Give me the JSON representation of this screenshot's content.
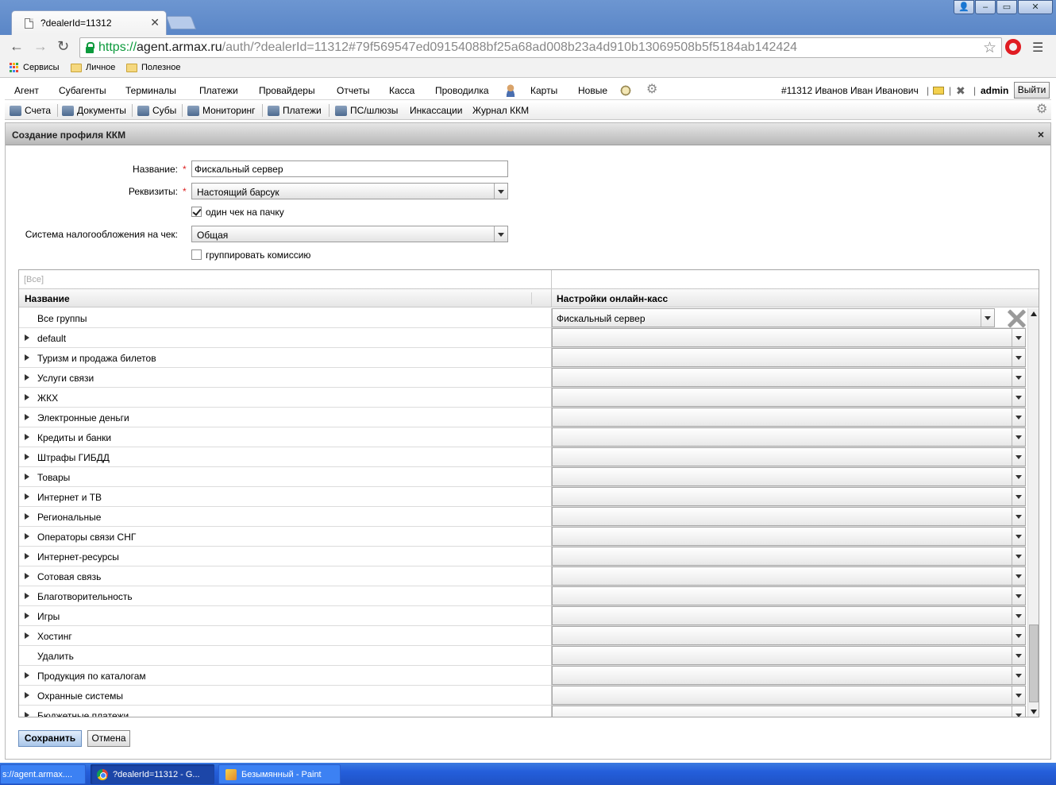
{
  "browser": {
    "tab_title": "?dealerId=11312",
    "url_scheme": "https://",
    "url_host": "agent.armax.ru",
    "url_path": "/auth/?dealerId=11312#79f569547ed09154088bf25a68ad008b23a4d910b13069508b5f5184ab142424",
    "bookmarks": [
      "Сервисы",
      "Личное",
      "Полезное"
    ]
  },
  "main_menu": {
    "items": [
      "Агент",
      "Субагенты",
      "Терминалы",
      "Платежи",
      "Провайдеры",
      "Отчеты",
      "Касса",
      "Проводилка",
      "Карты",
      "Новые"
    ],
    "user_info": "#11312 Иванов Иван Иванович",
    "sep": "|",
    "admin": "admin",
    "logout": "Выйти"
  },
  "sub_menu": {
    "items": [
      "Счета",
      "Документы",
      "Субы",
      "Мониторинг",
      "Платежи",
      "ПС/шлюзы",
      "Инкассации",
      "Журнал ККМ"
    ]
  },
  "dialog": {
    "title": "Создание профиля ККМ",
    "close": "×",
    "form": {
      "name_label": "Название:",
      "name_value": "Фискальный сервер",
      "requisites_label": "Реквизиты:",
      "requisites_value": "Настоящий барсук",
      "one_check_label": "один чек на пачку",
      "one_check_checked": true,
      "tax_label": "Система налогообложения на чек:",
      "tax_value": "Общая",
      "group_commission_label": "группировать комиссию",
      "group_commission_checked": false,
      "required_mark": "*"
    },
    "grid": {
      "filter_placeholder": "[Все]",
      "col_name": "Название",
      "col_settings": "Настройки онлайн-касс",
      "rows": [
        {
          "name": "Все группы",
          "expandable": false,
          "value": "Фискальный сервер"
        },
        {
          "name": "default",
          "expandable": true,
          "value": ""
        },
        {
          "name": "Туризм и продажа билетов",
          "expandable": true,
          "value": ""
        },
        {
          "name": "Услуги связи",
          "expandable": true,
          "value": ""
        },
        {
          "name": "ЖКХ",
          "expandable": true,
          "value": ""
        },
        {
          "name": "Электронные деньги",
          "expandable": true,
          "value": ""
        },
        {
          "name": "Кредиты и банки",
          "expandable": true,
          "value": ""
        },
        {
          "name": "Штрафы ГИБДД",
          "expandable": true,
          "value": ""
        },
        {
          "name": "Товары",
          "expandable": true,
          "value": ""
        },
        {
          "name": "Интернет и ТВ",
          "expandable": true,
          "value": ""
        },
        {
          "name": "Региональные",
          "expandable": true,
          "value": ""
        },
        {
          "name": "Операторы связи СНГ",
          "expandable": true,
          "value": ""
        },
        {
          "name": "Интернет-ресурсы",
          "expandable": true,
          "value": ""
        },
        {
          "name": "Сотовая связь",
          "expandable": true,
          "value": ""
        },
        {
          "name": "Благотворительность",
          "expandable": true,
          "value": ""
        },
        {
          "name": "Игры",
          "expandable": true,
          "value": ""
        },
        {
          "name": "Хостинг",
          "expandable": true,
          "value": ""
        },
        {
          "name": "Удалить",
          "expandable": false,
          "value": ""
        },
        {
          "name": "Продукция по каталогам",
          "expandable": true,
          "value": ""
        },
        {
          "name": "Охранные системы",
          "expandable": true,
          "value": ""
        },
        {
          "name": "Бюджетные платежи",
          "expandable": true,
          "value": ""
        }
      ]
    },
    "save_label": "Сохранить",
    "cancel_label": "Отмена"
  },
  "taskbar": {
    "items": [
      "s://agent.armax....",
      "?dealerId=11312 - G...",
      "Безымянный - Paint"
    ]
  },
  "colors": {
    "titlebar": "#5a86c7",
    "taskbar": "#245edb",
    "required": "#dd2222"
  }
}
